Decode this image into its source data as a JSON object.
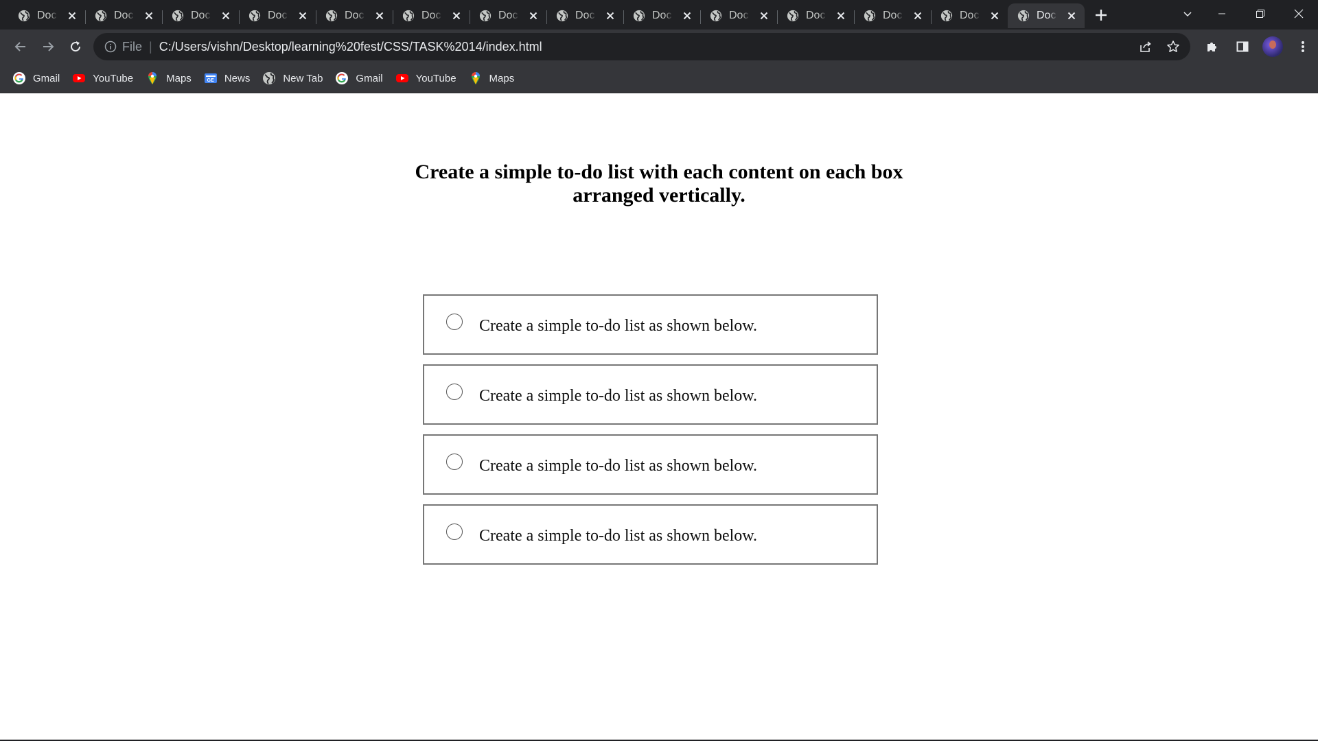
{
  "browser": {
    "tabs": [
      {
        "title": "Doc",
        "active": false
      },
      {
        "title": "Doc",
        "active": false
      },
      {
        "title": "Doc",
        "active": false
      },
      {
        "title": "Doc",
        "active": false
      },
      {
        "title": "Doc",
        "active": false
      },
      {
        "title": "Doc",
        "active": false
      },
      {
        "title": "Doc",
        "active": false
      },
      {
        "title": "Doc",
        "active": false
      },
      {
        "title": "Doc",
        "active": false
      },
      {
        "title": "Doc",
        "active": false
      },
      {
        "title": "Doc",
        "active": false
      },
      {
        "title": "Doc",
        "active": false
      },
      {
        "title": "Doc",
        "active": false
      },
      {
        "title": "Doc",
        "active": true
      }
    ],
    "omnibox": {
      "scheme_label": "File",
      "url": "C:/Users/vishn/Desktop/learning%20fest/CSS/TASK%2014/index.html"
    },
    "bookmarks": [
      {
        "label": "Gmail",
        "icon": "google-icon"
      },
      {
        "label": "YouTube",
        "icon": "youtube-icon"
      },
      {
        "label": "Maps",
        "icon": "maps-icon"
      },
      {
        "label": "News",
        "icon": "news-icon"
      },
      {
        "label": "New Tab",
        "icon": "globe-icon"
      },
      {
        "label": "Gmail",
        "icon": "google-icon"
      },
      {
        "label": "YouTube",
        "icon": "youtube-icon"
      },
      {
        "label": "Maps",
        "icon": "maps-icon"
      }
    ],
    "colors": {
      "tabstrip": "#202124",
      "toolbar": "#35363a",
      "text": "#e8eaed"
    }
  },
  "page": {
    "heading": "Create a simple to-do list with each content on each box arranged vertically.",
    "todos": [
      {
        "text": "Create a simple to-do list as shown below.",
        "checked": false
      },
      {
        "text": "Create a simple to-do list as shown below.",
        "checked": false
      },
      {
        "text": "Create a simple to-do list as shown below.",
        "checked": false
      },
      {
        "text": "Create a simple to-do list as shown below.",
        "checked": false
      }
    ]
  }
}
